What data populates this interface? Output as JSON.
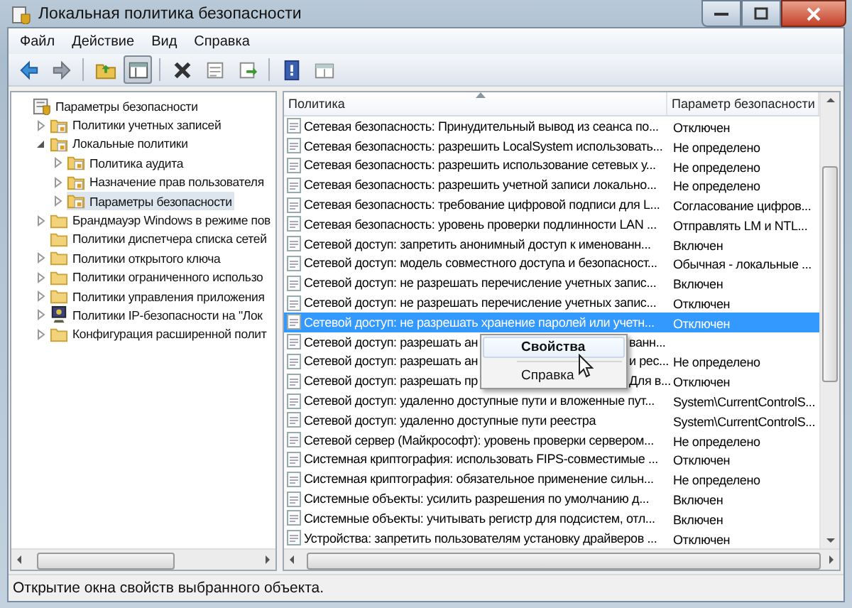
{
  "window": {
    "title": "Локальная политика безопасности"
  },
  "menu": [
    "Файл",
    "Действие",
    "Вид",
    "Справка"
  ],
  "toolbar": [
    {
      "kind": "back",
      "pressed": false
    },
    {
      "kind": "forward",
      "pressed": false
    },
    {
      "kind": "sep"
    },
    {
      "kind": "up",
      "pressed": false
    },
    {
      "kind": "tree",
      "pressed": true
    },
    {
      "kind": "sep"
    },
    {
      "kind": "delete",
      "pressed": false
    },
    {
      "kind": "properties",
      "pressed": false
    },
    {
      "kind": "export",
      "pressed": false
    },
    {
      "kind": "sep"
    },
    {
      "kind": "help",
      "pressed": false
    },
    {
      "kind": "view",
      "pressed": false
    }
  ],
  "tree": [
    {
      "label": "Параметры безопасности",
      "kind": "root",
      "selected": false,
      "children": [
        {
          "label": "Политики учетных записей",
          "kind": "policy-folder",
          "expanded": false,
          "selected": false
        },
        {
          "label": "Локальные политики",
          "kind": "policy-folder",
          "expanded": true,
          "selected": false,
          "children": [
            {
              "label": "Политика аудита",
              "kind": "policy-folder",
              "expanded": false,
              "selected": false
            },
            {
              "label": "Назначение прав пользователя",
              "kind": "policy-folder",
              "expanded": false,
              "selected": false
            },
            {
              "label": "Параметры безопасности",
              "kind": "policy-folder",
              "expanded": false,
              "selected": true
            }
          ]
        },
        {
          "label": "Брандмауэр Windows в режиме пов",
          "kind": "folder",
          "expanded": false,
          "selected": false
        },
        {
          "label": "Политики диспетчера списка сетей",
          "kind": "folder",
          "selected": false
        },
        {
          "label": "Политики открытого ключа",
          "kind": "folder",
          "expanded": false,
          "selected": false
        },
        {
          "label": "Политики ограниченного использо",
          "kind": "folder",
          "expanded": false,
          "selected": false
        },
        {
          "label": "Политики управления приложения",
          "kind": "folder",
          "expanded": false,
          "selected": false
        },
        {
          "label": "Политики IP-безопасности на \"Лок",
          "kind": "ip-security",
          "expanded": false,
          "selected": false
        },
        {
          "label": "Конфигурация расширенной полит",
          "kind": "folder",
          "expanded": false,
          "selected": false
        }
      ]
    }
  ],
  "table": {
    "columns": [
      {
        "label": "Политика",
        "sorted": true
      },
      {
        "label": "Параметр безопасности",
        "sorted": false
      }
    ],
    "rows": [
      {
        "policy": "Сетевая безопасность: Принудительный вывод из сеанса по...",
        "value": "Отключен",
        "selected": false
      },
      {
        "policy": "Сетевая безопасность: разрешить LocalSystem использовать...",
        "value": "Не определено",
        "selected": false
      },
      {
        "policy": "Сетевая безопасность: разрешить использование сетевых у...",
        "value": "Не определено",
        "selected": false
      },
      {
        "policy": "Сетевая безопасность: разрешить учетной записи локально...",
        "value": "Не определено",
        "selected": false
      },
      {
        "policy": "Сетевая безопасность: требование цифровой подписи для L...",
        "value": "Согласование цифров...",
        "selected": false
      },
      {
        "policy": "Сетевая безопасность: уровень проверки подлинности LAN ...",
        "value": "Отправлять LM и NTL...",
        "selected": false
      },
      {
        "policy": "Сетевой доступ: запретить анонимный доступ к именованн...",
        "value": "Включен",
        "selected": false
      },
      {
        "policy": "Сетевой доступ: модель совместного доступа и безопасност...",
        "value": "Обычная - локальные ...",
        "selected": false
      },
      {
        "policy": "Сетевой доступ: не разрешать перечисление учетных запис...",
        "value": "Включен",
        "selected": false
      },
      {
        "policy": "Сетевой доступ: не разрешать перечисление учетных запис...",
        "value": "Отключен",
        "selected": false
      },
      {
        "policy": "Сетевой доступ: не разрешать хранение паролей или учетн...",
        "value": "Отключен",
        "selected": true
      },
      {
        "policy": "Сетевой доступ: разрешать ан",
        "policy_tail": "ванн...",
        "selected": false
      },
      {
        "policy": "Сетевой доступ: разрешать ан",
        "policy_tail": "и рес...",
        "value": "Не определено",
        "selected": false
      },
      {
        "policy": "Сетевой доступ: разрешать пр",
        "policy_tail": "Для в...",
        "value": "Отключен",
        "selected": false
      },
      {
        "policy": "Сетевой доступ: удаленно доступные пути и вложенные пут...",
        "value": "System\\CurrentControlS...",
        "selected": false
      },
      {
        "policy": "Сетевой доступ: удаленно доступные пути реестра",
        "value": "System\\CurrentControlS...",
        "selected": false
      },
      {
        "policy": "Сетевой сервер (Майкрософт): уровень проверки сервером...",
        "value": "Не определено",
        "selected": false
      },
      {
        "policy": "Системная криптография: использовать FIPS-совместимые ...",
        "value": "Отключен",
        "selected": false
      },
      {
        "policy": "Системная криптография: обязательное применение сильн...",
        "value": "Не определено",
        "selected": false
      },
      {
        "policy": "Системные объекты: усилить разрешения по умолчанию д...",
        "value": "Включен",
        "selected": false
      },
      {
        "policy": "Системные объекты: учитывать регистр для подсистем, отл...",
        "value": "Включен",
        "selected": false
      },
      {
        "policy": "Устройства: запретить пользователям установку драйверов ...",
        "value": "Отключен",
        "selected": false
      }
    ]
  },
  "context_menu": [
    {
      "label": "Свойства",
      "default": true
    },
    {
      "kind": "separator"
    },
    {
      "label": "Справка",
      "default": false
    }
  ],
  "status_bar": "Открытие окна свойств выбранного объекта."
}
